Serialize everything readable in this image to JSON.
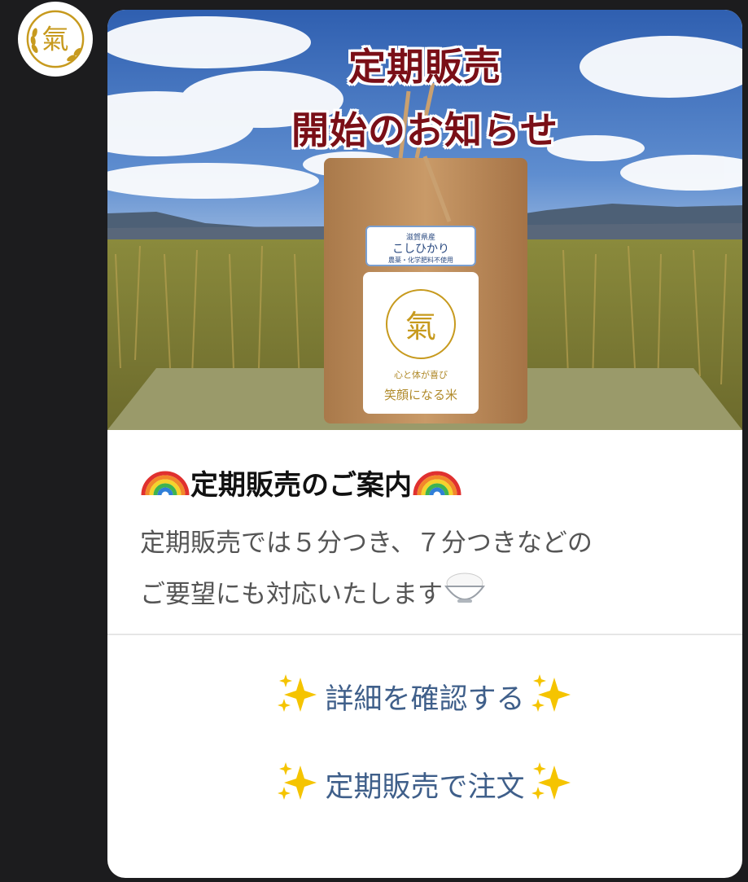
{
  "avatar": {
    "glyph": "氣",
    "icon": "rice-ki-logo-icon",
    "color": "#c79a1e"
  },
  "hero": {
    "title_line1": "定期販売",
    "title_line2": "開始のお知らせ",
    "bag": {
      "label_region": "滋賀県産",
      "label_name": "こしひかり",
      "label_note": "農薬・化学肥料不使用",
      "logo_glyph": "氣",
      "slogan1": "心と体が喜び",
      "slogan2": "笑顔になる米"
    }
  },
  "message": {
    "heading": "定期販売のご案内",
    "heading_icon": "rainbow-icon",
    "description_line1": "定期販売では５分つき、７分つきなどの",
    "description_line2": "ご要望にも対応いたします",
    "description_icon": "rice-bowl-icon"
  },
  "actions": [
    {
      "label": "詳細を確認する",
      "icon": "sparkles-icon"
    },
    {
      "label": "定期販売で注文",
      "icon": "sparkles-icon"
    }
  ],
  "colors": {
    "background": "#1c1c1e",
    "card": "#ffffff",
    "link": "#3f5f8a",
    "title_red": "#7a0f17",
    "logo_gold": "#c79a1e"
  }
}
